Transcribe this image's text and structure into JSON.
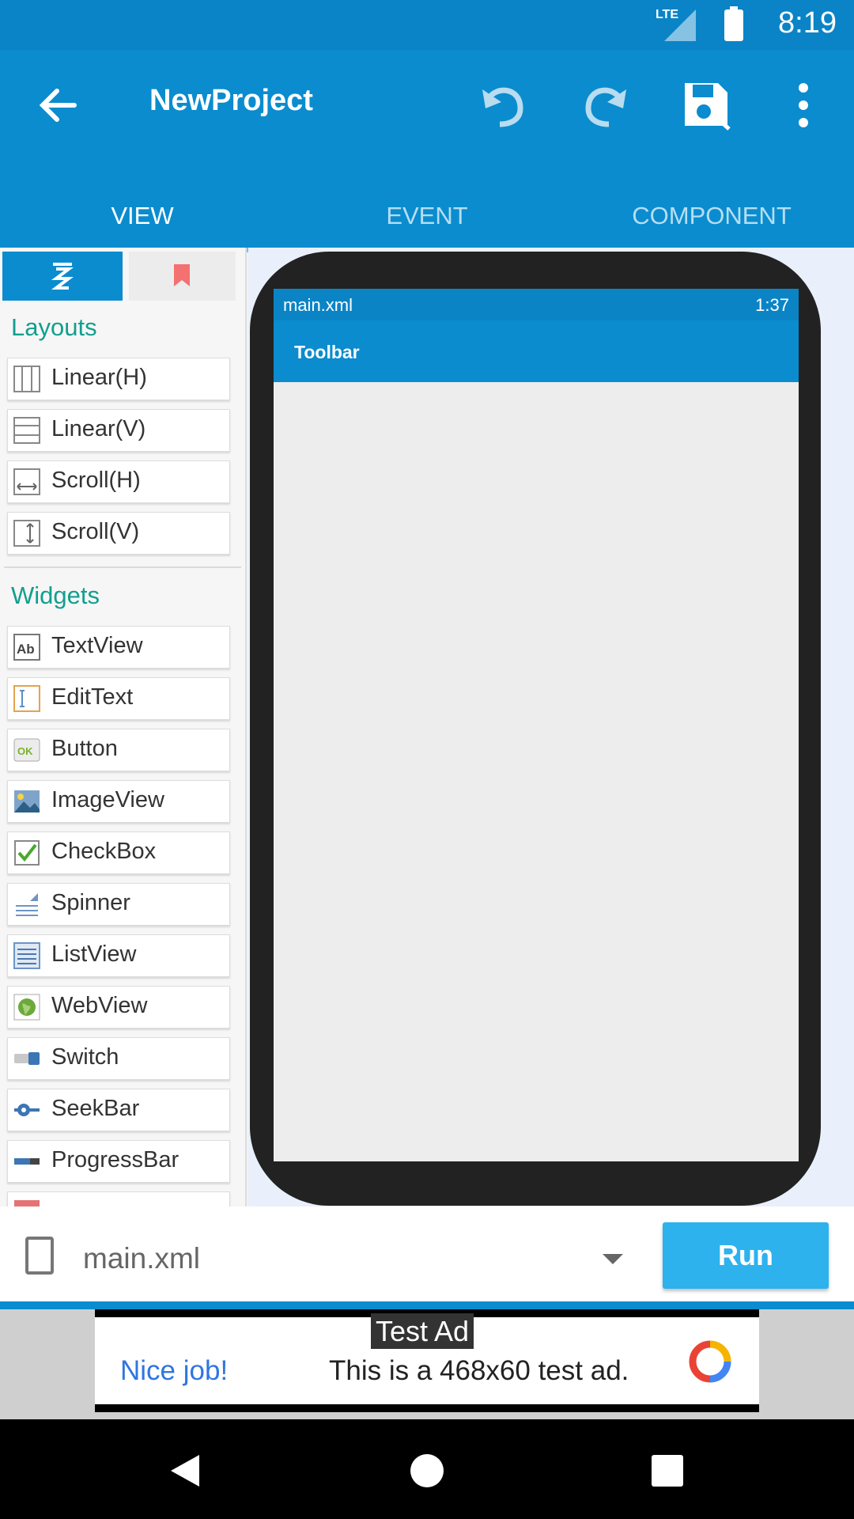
{
  "status_bar": {
    "network": "LTE",
    "time": "8:19"
  },
  "app_bar": {
    "title": "NewProject",
    "icons": [
      "back-arrow-icon",
      "undo-icon",
      "redo-icon",
      "save-icon",
      "more-vert-icon"
    ]
  },
  "tabs": [
    {
      "label": "VIEW",
      "active": true
    },
    {
      "label": "EVENT",
      "active": false
    },
    {
      "label": "COMPONENT",
      "active": false
    }
  ],
  "palette": {
    "layouts_title": "Layouts",
    "layouts": [
      "Linear(H)",
      "Linear(V)",
      "Scroll(H)",
      "Scroll(V)"
    ],
    "widgets_title": "Widgets",
    "widgets": [
      "TextView",
      "EditText",
      "Button",
      "ImageView",
      "CheckBox",
      "Spinner",
      "ListView",
      "WebView",
      "Switch",
      "SeekBar",
      "ProgressBar"
    ]
  },
  "preview": {
    "layout_name": "main.xml",
    "clock": "1:37",
    "toolbar_title": "Toolbar"
  },
  "bottom": {
    "file": "main.xml",
    "run_label": "Run"
  },
  "ad": {
    "label": "Test Ad",
    "headline": "Nice job!",
    "message": "This is a 468x60 test ad."
  },
  "colors": {
    "primary": "#0a8ccf",
    "accent": "#2db2ee",
    "section": "#129f8e"
  }
}
